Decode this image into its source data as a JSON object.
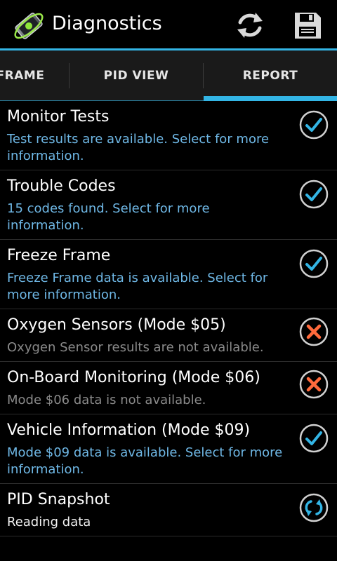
{
  "app": {
    "title": "Diagnostics"
  },
  "actions": {
    "refresh_icon": "refresh-icon",
    "save_icon": "save-icon"
  },
  "tabs": [
    {
      "label": "FRAME",
      "selected": false
    },
    {
      "label": "PID VIEW",
      "selected": false
    },
    {
      "label": "REPORT",
      "selected": true
    }
  ],
  "colors": {
    "accent": "#33b5e5",
    "link_text": "#6fb8e6",
    "muted_text": "#8a8a8a",
    "error": "#ff6a3c"
  },
  "report": {
    "items": [
      {
        "title": "Monitor Tests",
        "subtitle": "Test results are available. Select for more information.",
        "status": "available",
        "icon": "check-circle-icon"
      },
      {
        "title": "Trouble Codes",
        "subtitle": "15 codes found. Select for more information.",
        "status": "available",
        "icon": "check-circle-icon"
      },
      {
        "title": "Freeze Frame",
        "subtitle": "Freeze Frame data is available. Select for more information.",
        "status": "available",
        "icon": "check-circle-icon"
      },
      {
        "title": "Oxygen Sensors (Mode $05)",
        "subtitle": "Oxygen Sensor results are not available.",
        "status": "unavailable",
        "icon": "x-circle-icon"
      },
      {
        "title": "On-Board Monitoring (Mode $06)",
        "subtitle": "Mode $06 data is not available.",
        "status": "unavailable",
        "icon": "x-circle-icon"
      },
      {
        "title": "Vehicle Information (Mode $09)",
        "subtitle": "Mode $09 data is available. Select for more information.",
        "status": "available",
        "icon": "check-circle-icon"
      },
      {
        "title": "PID Snapshot",
        "subtitle": "Reading data",
        "status": "loading",
        "icon": "loading-circle-icon"
      }
    ]
  }
}
